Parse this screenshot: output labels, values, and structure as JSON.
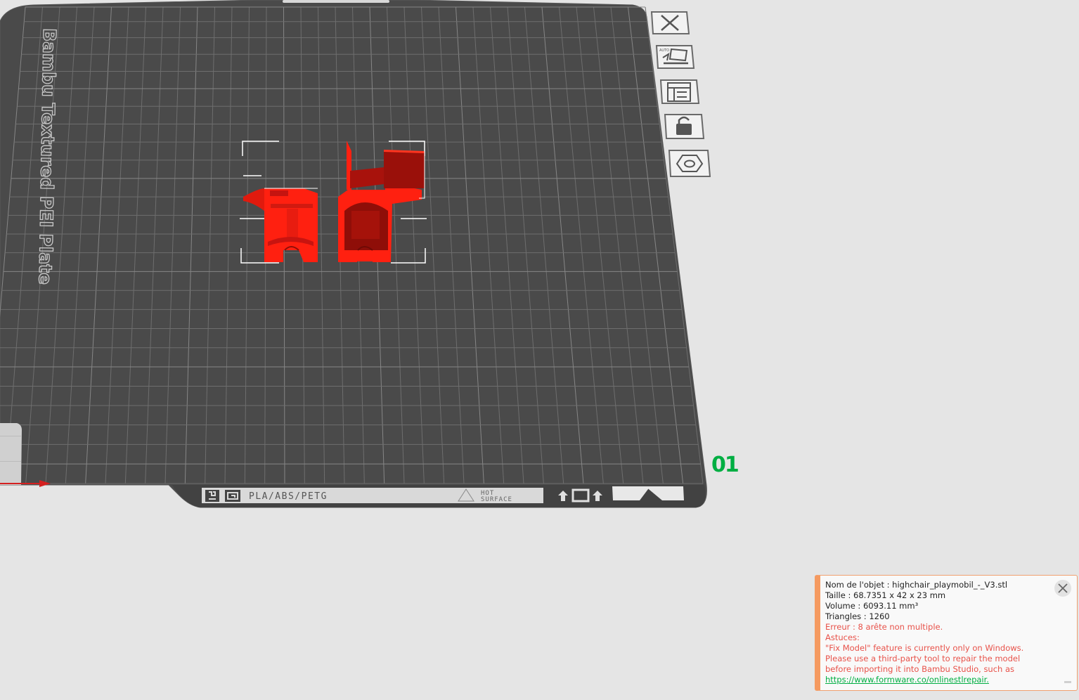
{
  "plate": {
    "name_label": "Bambu Textured PEI Plate",
    "material_label": "PLA/ABS/PETG",
    "hot_label_1": "HOT",
    "hot_label_2": "SURFACE",
    "plate_number": "01"
  },
  "toolbar": [
    {
      "name": "close-plate-icon"
    },
    {
      "name": "auto-orient-icon"
    },
    {
      "name": "arrange-icon"
    },
    {
      "name": "lock-plate-icon"
    },
    {
      "name": "plate-settings-icon"
    }
  ],
  "notification": {
    "name_line": "Nom de l'objet : highchair_playmobil_-_V3.stl",
    "size_line": "Taille : 68.7351 x 42 x 23 mm",
    "volume_line": "Volume : 6093.11 mm³",
    "triangles_line": "Triangles : 1260",
    "error_line": "Erreur : 8 arête non multiple.",
    "tips_label": "Astuces:",
    "tip_line_1": "\"Fix Model\" feature is currently only on Windows.",
    "tip_line_2": "Please use a third-party tool to repair the model",
    "tip_line_3": "before importing it into Bambu Studio, such as",
    "link": "https://www.formware.co/onlinestlrepair."
  },
  "colors": {
    "background": "#e5e5e5",
    "plate": "#4a4a4a",
    "grid": "#6e6e6e",
    "model": "#ff2010",
    "accent": "#00ae42",
    "error": "#e8524a",
    "notification_border": "#f59a60"
  }
}
